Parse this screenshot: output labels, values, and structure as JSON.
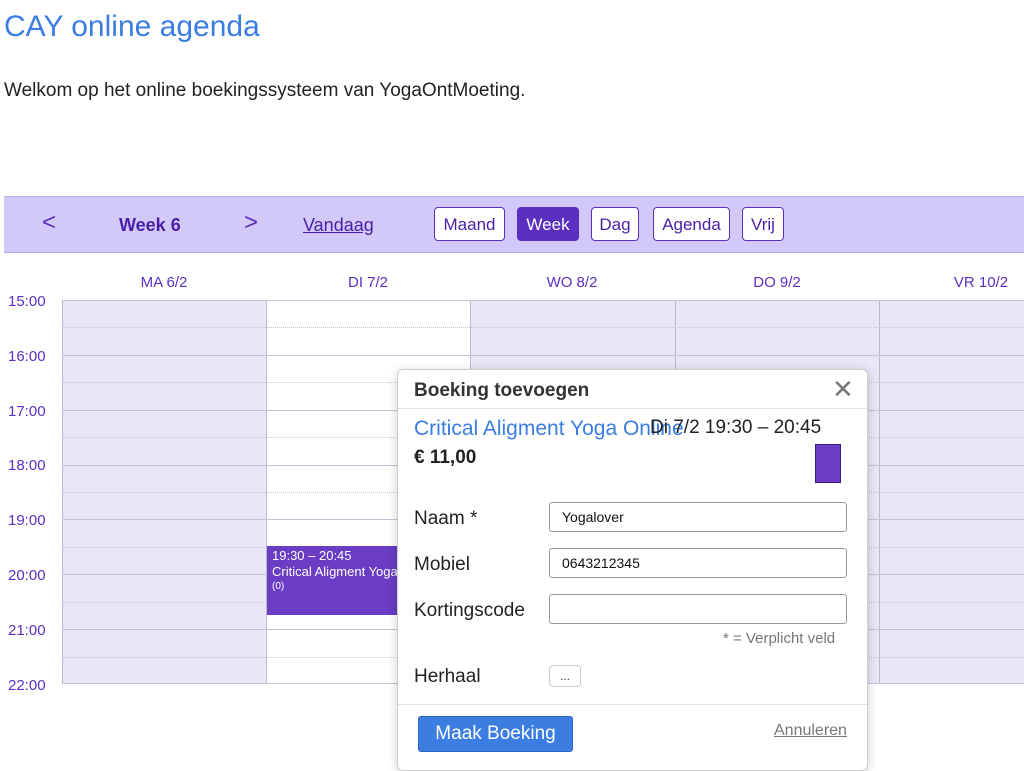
{
  "page": {
    "title": "CAY online agenda",
    "intro": "Welkom op het online boekingssysteem van YogaOntMoeting."
  },
  "toolbar": {
    "prev_icon": "chevron-left-icon",
    "prev_glyph": "<",
    "week_label": "Week 6",
    "next_icon": "chevron-right-icon",
    "next_glyph": ">",
    "today_label": "Vandaag",
    "views": [
      {
        "label": "Maand",
        "active": false
      },
      {
        "label": "Week",
        "active": true
      },
      {
        "label": "Dag",
        "active": false
      },
      {
        "label": "Agenda",
        "active": false
      },
      {
        "label": "Vrij",
        "active": false
      }
    ]
  },
  "calendar": {
    "days": [
      "MA 6/2",
      "DI 7/2",
      "WO 8/2",
      "DO 9/2",
      "VR 10/2"
    ],
    "hours": [
      "15:00",
      "16:00",
      "17:00",
      "18:00",
      "19:00",
      "20:00",
      "21:00",
      "22:00"
    ],
    "event": {
      "time": "19:30 – 20:45",
      "title": "Critical Aligment Yoga Online",
      "count": "(0)"
    }
  },
  "dialog": {
    "title": "Boeking toevoegen",
    "close_glyph": "✕",
    "class_name": "Critical Aligment Yoga Online",
    "class_time": "Di 7/2 19:30 – 20:45",
    "price": "€ 11,00",
    "fields": {
      "name_label": "Naam *",
      "name_value": "Yogalover",
      "mobile_label": "Mobiel",
      "mobile_value": "0643212345",
      "discount_label": "Kortingscode",
      "discount_value": ""
    },
    "required_note": "* = Verplicht veld",
    "repeat_label": "Herhaal",
    "repeat_button": "...",
    "submit_label": "Maak Boeking",
    "cancel_label": "Annuleren"
  },
  "colors": {
    "accent": "#5b2fc0",
    "event": "#6a3dc4",
    "toolbar_bg": "#d2c9f8",
    "link_blue": "#3b7de0"
  }
}
